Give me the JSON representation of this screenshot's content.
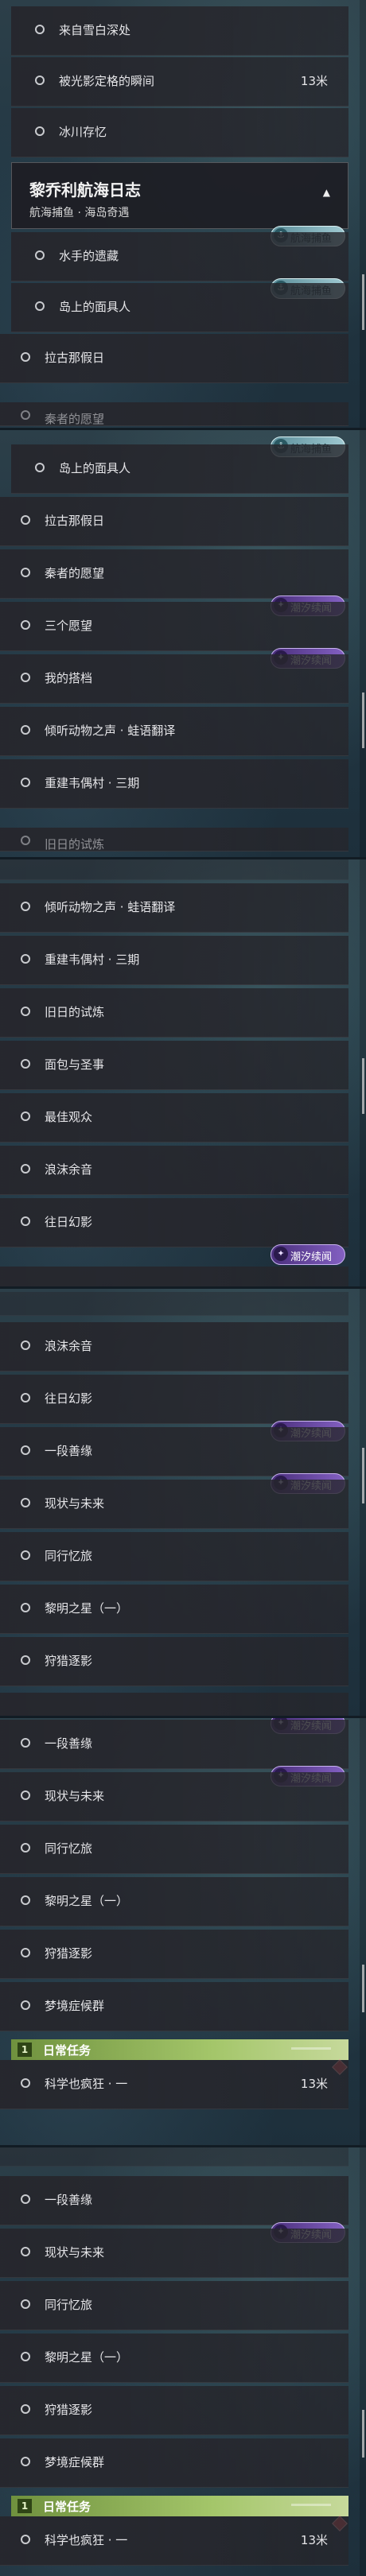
{
  "labels": {
    "snow": "来自雪白深处",
    "freeze": "被光影定格的瞬间",
    "ice": "冰川存忆",
    "sailor": "水手的遗藏",
    "island": "岛上的面具人",
    "lagu": "拉古那假日",
    "qin": "秦者的愿望",
    "three": "三个愿望",
    "mine": "我的搭档",
    "listen": "倾听动物之声 · 蛙语翻译",
    "rebuild": "重建韦偶村 · 三期",
    "old": "旧日的试炼",
    "bread": "面包与圣事",
    "best": "最佳观众",
    "foam": "浪沫余音",
    "past": "往日幻影",
    "good": "一段善缘",
    "reality": "现状与未来",
    "travel": "同行忆旅",
    "star": "黎明之星（一）",
    "hunt": "狩猎逐影",
    "dream": "梦境症候群",
    "science": "科学也疯狂 · 一"
  },
  "section": {
    "title": "黎乔利航海日志",
    "subtitle": "航海捕鱼 · 海岛奇遇",
    "arrow": "▲"
  },
  "distance": "13米",
  "badges": {
    "sea": "航海捕鱼",
    "tide": "潮汐续闻",
    "sea_icon": "⚓",
    "tide_icon": "✦"
  },
  "daily": {
    "label": "日常任务",
    "icon": "1"
  },
  "colors": {
    "row_bg": "#26262c",
    "daily_green": "#8fb25a",
    "tide_purple": "#6a48a8",
    "sea_teal": "#7fb0b9",
    "alert_red": "#d44b50"
  }
}
